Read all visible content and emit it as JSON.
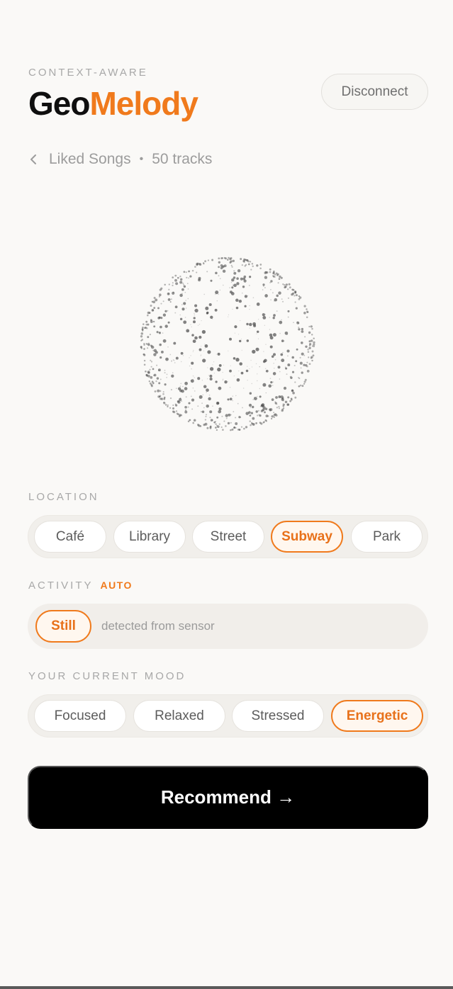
{
  "header": {
    "eyebrow": "CONTEXT-AWARE",
    "brand_part1": "Geo",
    "brand_part2": "Melody",
    "disconnect_label": "Disconnect"
  },
  "playlist": {
    "name": "Liked Songs",
    "separator": "•",
    "track_count": "50 tracks"
  },
  "location": {
    "label": "LOCATION",
    "options": [
      "Café",
      "Library",
      "Street",
      "Subway",
      "Park"
    ],
    "selected": "Subway"
  },
  "activity": {
    "label": "ACTIVITY",
    "badge": "AUTO",
    "value": "Still",
    "note": "detected from sensor"
  },
  "mood": {
    "label": "YOUR CURRENT MOOD",
    "options": [
      "Focused",
      "Relaxed",
      "Stressed",
      "Energetic"
    ],
    "selected": "Energetic"
  },
  "action": {
    "recommend_label": "Recommend →"
  },
  "colors": {
    "accent": "#f07a1c",
    "background": "#faf9f7",
    "button": "#000000"
  },
  "icons": {
    "back": "chevron-left-icon",
    "visual": "particle-sphere"
  }
}
